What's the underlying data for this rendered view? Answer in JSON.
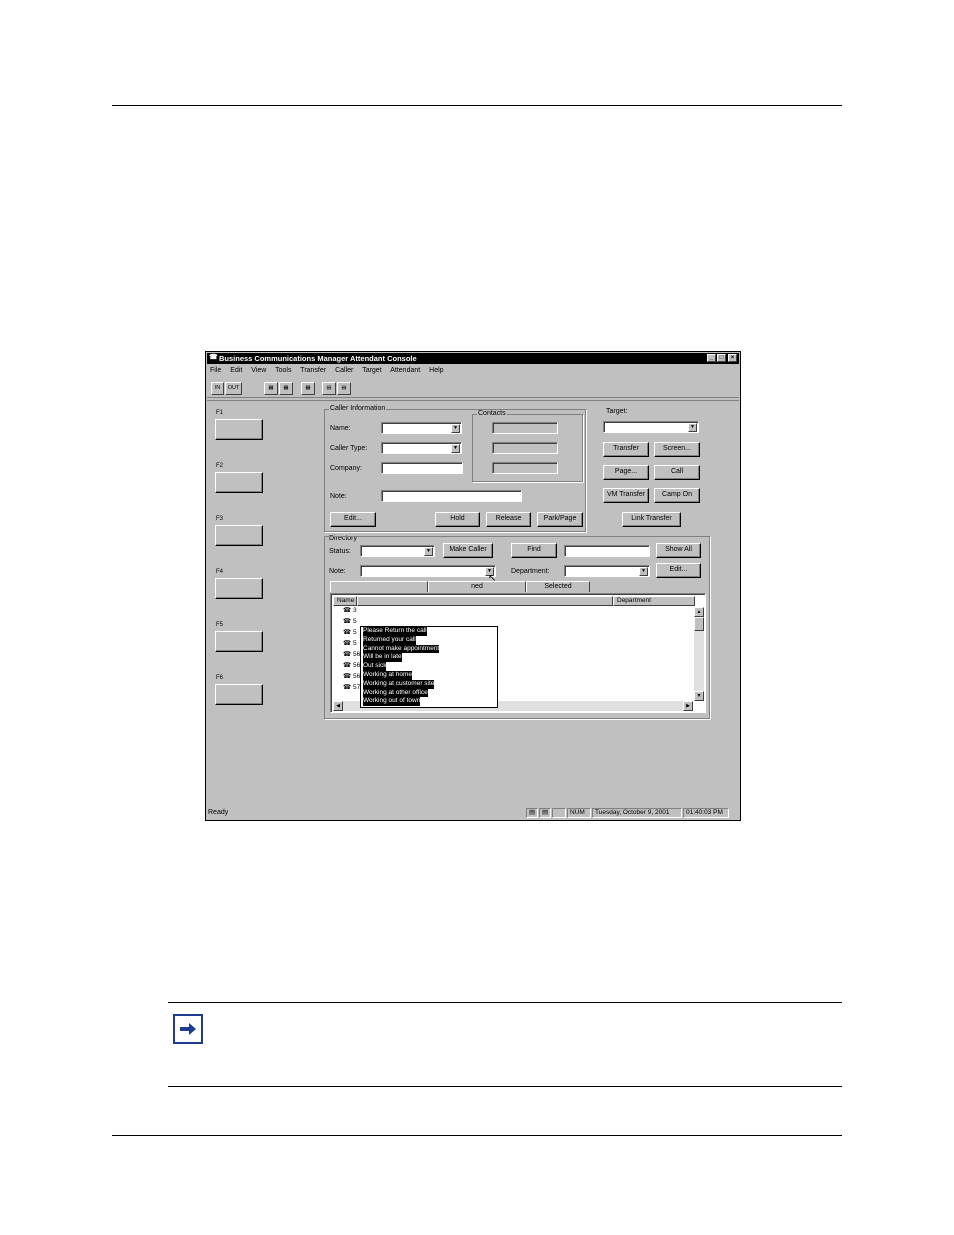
{
  "window": {
    "title": "Business Communications Manager Attendant Console",
    "menu": [
      "File",
      "Edit",
      "View",
      "Tools",
      "Transfer",
      "Caller",
      "Target",
      "Attendant",
      "Help"
    ],
    "toolbar": {
      "in_label": "IN",
      "out_label": "OUT"
    }
  },
  "fkeys": [
    "F1",
    "F2",
    "F3",
    "F4",
    "F5",
    "F6"
  ],
  "caller_info": {
    "group_label": "Caller Information",
    "name_label": "Name:",
    "caller_type_label": "Caller Type:",
    "company_label": "Company:",
    "note_label": "Note:",
    "contacts_label": "Contacts",
    "edit_button": "Edit...",
    "hold_button": "Hold",
    "release_button": "Release",
    "park_page_button": "Park/Page"
  },
  "target": {
    "label": "Target:",
    "transfer_button": "Transfer",
    "screen_button": "Screen...",
    "page_button": "Page...",
    "call_button": "Call",
    "vm_transfer_button": "VM Transfer",
    "camp_on_button": "Camp On",
    "link_transfer_button": "Link Transfer"
  },
  "directory": {
    "group_label": "Directory",
    "status_label": "Status:",
    "make_caller_button": "Make Caller",
    "find_button": "Find",
    "show_all_button": "Show All",
    "note_label": "Note:",
    "department_label": "Department:",
    "edit_button": "Edit...",
    "tabs": [
      "",
      "ned",
      "Selected"
    ],
    "columns": [
      "Name",
      "",
      "Department"
    ],
    "rows": [
      {
        "name": "3",
        "ext": ""
      },
      {
        "name": "5",
        "ext": ""
      },
      {
        "name": "5",
        "ext": ""
      },
      {
        "name": "5",
        "ext": ""
      },
      {
        "name": "567",
        "ext": "567"
      },
      {
        "name": "568",
        "ext": "568"
      },
      {
        "name": "569",
        "ext": "569"
      },
      {
        "name": "570",
        "ext": "570"
      }
    ],
    "note_options": [
      "Please Return the call",
      "Returned your call",
      "Cannot make appointment",
      "Will be in late",
      "Out sick",
      "Working at home",
      "Working at customer site",
      "Working at other office",
      "Working out of town"
    ]
  },
  "statusbar": {
    "ready": "Ready",
    "num": "NUM",
    "date": "Tuesday, October 9, 2001",
    "time": "01:40:03 PM"
  }
}
